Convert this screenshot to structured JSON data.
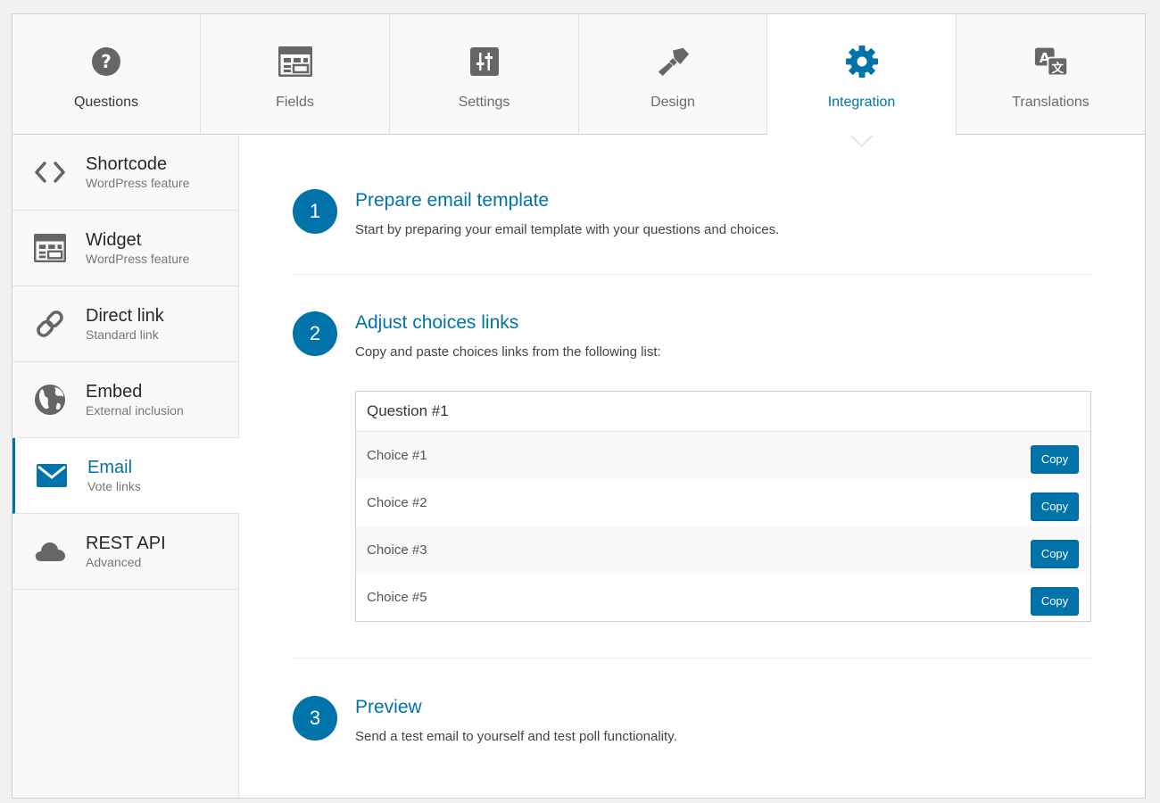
{
  "colors": {
    "accent": "#0073aa",
    "icon_gray": "#666666"
  },
  "tabs": [
    {
      "label": "Questions",
      "icon": "question-circle-icon"
    },
    {
      "label": "Fields",
      "icon": "fields-table-icon"
    },
    {
      "label": "Settings",
      "icon": "sliders-icon"
    },
    {
      "label": "Design",
      "icon": "paintbrush-icon"
    },
    {
      "label": "Integration",
      "icon": "gear-icon",
      "active": true
    },
    {
      "label": "Translations",
      "icon": "translate-icon"
    }
  ],
  "sidebar": {
    "items": [
      {
        "title": "Shortcode",
        "subtitle": "WordPress feature",
        "icon": "code-brackets-icon"
      },
      {
        "title": "Widget",
        "subtitle": "WordPress feature",
        "icon": "widget-icon"
      },
      {
        "title": "Direct link",
        "subtitle": "Standard link",
        "icon": "link-icon"
      },
      {
        "title": "Embed",
        "subtitle": "External inclusion",
        "icon": "globe-icon"
      },
      {
        "title": "Email",
        "subtitle": "Vote links",
        "icon": "envelope-icon",
        "active": true
      },
      {
        "title": "REST API",
        "subtitle": "Advanced",
        "icon": "cloud-icon"
      }
    ]
  },
  "steps": [
    {
      "number": "1",
      "title": "Prepare email template",
      "description": "Start by preparing your email template with your questions and choices."
    },
    {
      "number": "2",
      "title": "Adjust choices links",
      "description": "Copy and paste choices links from the following list:"
    },
    {
      "number": "3",
      "title": "Preview",
      "description": "Send a test email to yourself and test poll functionality."
    }
  ],
  "choices_table": {
    "question": "Question #1",
    "copy_label": "Copy",
    "rows": [
      {
        "choice": "Choice #1"
      },
      {
        "choice": "Choice #2"
      },
      {
        "choice": "Choice #3"
      },
      {
        "choice": "Choice #5"
      }
    ]
  }
}
